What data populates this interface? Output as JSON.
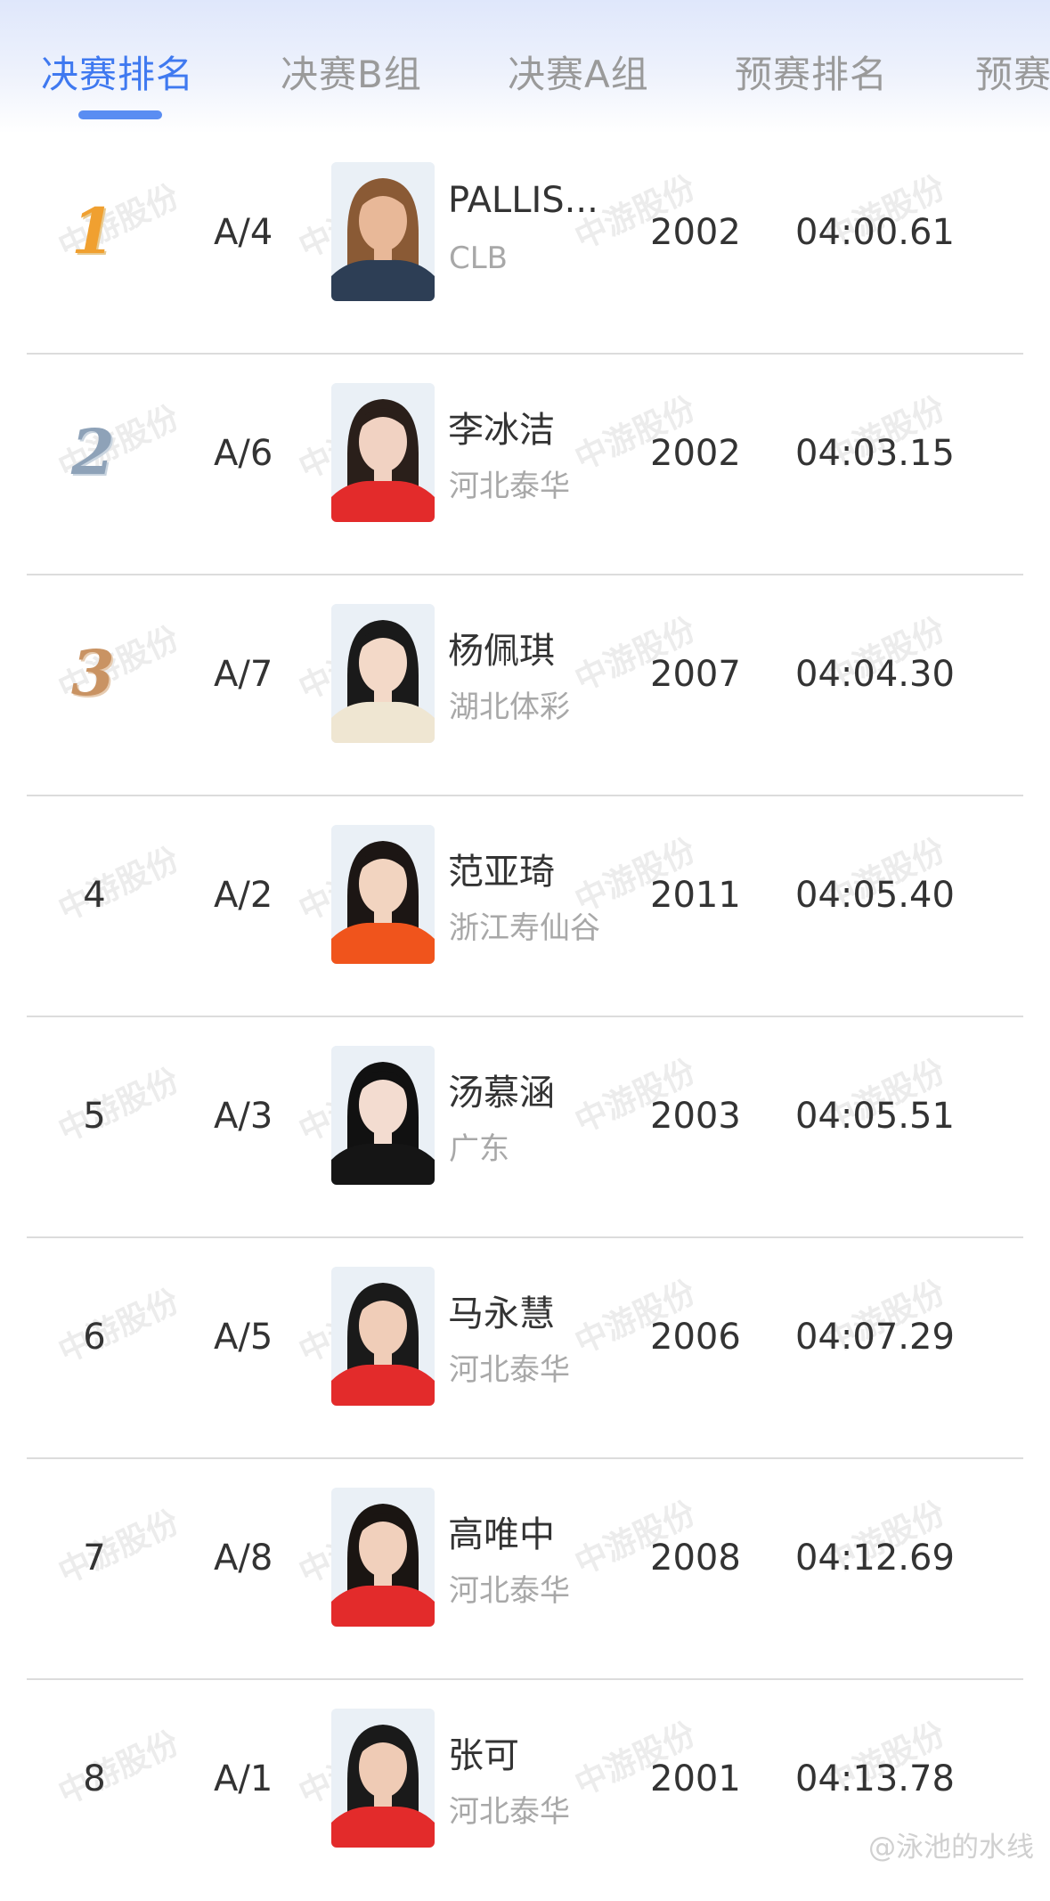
{
  "tabs": [
    {
      "label": "决赛排名",
      "active": true
    },
    {
      "label": "决赛B组",
      "active": false
    },
    {
      "label": "决赛A组",
      "active": false
    },
    {
      "label": "预赛排名",
      "active": false
    },
    {
      "label": "预赛",
      "active": false
    }
  ],
  "rows": [
    {
      "rank": "1",
      "medal": "gold",
      "lane": "A/4",
      "name": "PALLIS...",
      "team": "CLB",
      "year": "2002",
      "time": "04:00.61",
      "shirt": "#2d3e55",
      "hair": "#8a5a35",
      "skin": "#e8b898"
    },
    {
      "rank": "2",
      "medal": "silver",
      "lane": "A/6",
      "name": "李冰洁",
      "team": "河北泰华",
      "year": "2002",
      "time": "04:03.15",
      "shirt": "#e32b2b",
      "hair": "#2a1f1a",
      "skin": "#f1d2c2"
    },
    {
      "rank": "3",
      "medal": "bronze",
      "lane": "A/7",
      "name": "杨佩琪",
      "team": "湖北体彩",
      "year": "2007",
      "time": "04:04.30",
      "shirt": "#efe6d2",
      "hair": "#1a1a1a",
      "skin": "#f3d9c8"
    },
    {
      "rank": "4",
      "medal": "",
      "lane": "A/2",
      "name": "范亚琦",
      "team": "浙江寿仙谷",
      "year": "2011",
      "time": "04:05.40",
      "shirt": "#f0541c",
      "hair": "#1c1614",
      "skin": "#f2d4c0"
    },
    {
      "rank": "5",
      "medal": "",
      "lane": "A/3",
      "name": "汤慕涵",
      "team": "广东",
      "year": "2003",
      "time": "04:05.51",
      "shirt": "#151515",
      "hair": "#111111",
      "skin": "#f3dcd0"
    },
    {
      "rank": "6",
      "medal": "",
      "lane": "A/5",
      "name": "马永慧",
      "team": "河北泰华",
      "year": "2006",
      "time": "04:07.29",
      "shirt": "#e32b2b",
      "hair": "#1a1a1a",
      "skin": "#f0cdb8"
    },
    {
      "rank": "7",
      "medal": "",
      "lane": "A/8",
      "name": "高唯中",
      "team": "河北泰华",
      "year": "2008",
      "time": "04:12.69",
      "shirt": "#e32b2b",
      "hair": "#1a1512",
      "skin": "#f1d0bc"
    },
    {
      "rank": "8",
      "medal": "",
      "lane": "A/1",
      "name": "张可",
      "team": "河北泰华",
      "year": "2001",
      "time": "04:13.78",
      "shirt": "#e32b2b",
      "hair": "#1a1a1a",
      "skin": "#efcbb5"
    }
  ],
  "watermark_text": "中游股份",
  "footer_watermark": "@泳池的水线",
  "colors": {
    "accent": "#3f79f0",
    "text": "#333333",
    "muted": "#a8a8a8"
  }
}
